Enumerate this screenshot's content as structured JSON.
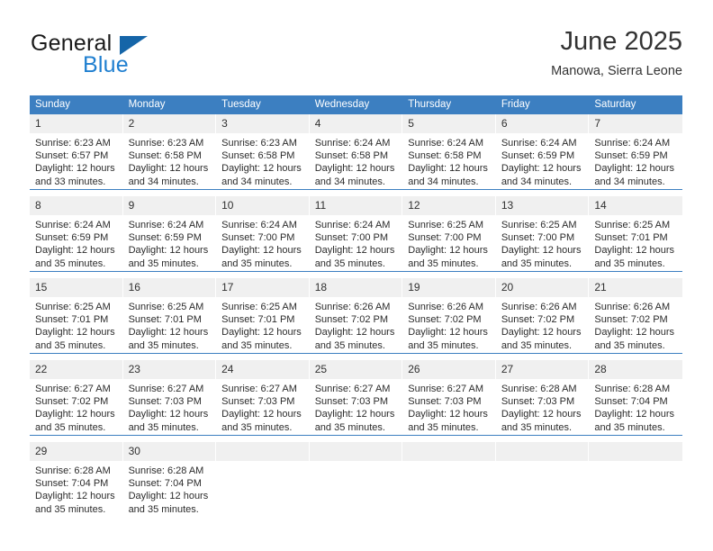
{
  "brand": {
    "name_part1": "General",
    "name_part2": "Blue",
    "triangle_icon": "brand-triangle-icon",
    "color_dark": "#1a1a1a",
    "color_blue": "#1f7fd0",
    "color_triangle": "#1565a8"
  },
  "header": {
    "title": "June 2025",
    "subtitle": "Manowa, Sierra Leone"
  },
  "theme": {
    "header_row_bg": "#3c7fc1",
    "header_row_text": "#ffffff",
    "daynum_bg": "#f0f0f0",
    "cell_bg": "#ffffff",
    "separator": "#3c7fc1"
  },
  "calendar": {
    "weekday_headers": [
      "Sunday",
      "Monday",
      "Tuesday",
      "Wednesday",
      "Thursday",
      "Friday",
      "Saturday"
    ],
    "weeks": [
      [
        {
          "day": "1",
          "sunrise": "Sunrise: 6:23 AM",
          "sunset": "Sunset: 6:57 PM",
          "daylight1": "Daylight: 12 hours",
          "daylight2": "and 33 minutes."
        },
        {
          "day": "2",
          "sunrise": "Sunrise: 6:23 AM",
          "sunset": "Sunset: 6:58 PM",
          "daylight1": "Daylight: 12 hours",
          "daylight2": "and 34 minutes."
        },
        {
          "day": "3",
          "sunrise": "Sunrise: 6:23 AM",
          "sunset": "Sunset: 6:58 PM",
          "daylight1": "Daylight: 12 hours",
          "daylight2": "and 34 minutes."
        },
        {
          "day": "4",
          "sunrise": "Sunrise: 6:24 AM",
          "sunset": "Sunset: 6:58 PM",
          "daylight1": "Daylight: 12 hours",
          "daylight2": "and 34 minutes."
        },
        {
          "day": "5",
          "sunrise": "Sunrise: 6:24 AM",
          "sunset": "Sunset: 6:58 PM",
          "daylight1": "Daylight: 12 hours",
          "daylight2": "and 34 minutes."
        },
        {
          "day": "6",
          "sunrise": "Sunrise: 6:24 AM",
          "sunset": "Sunset: 6:59 PM",
          "daylight1": "Daylight: 12 hours",
          "daylight2": "and 34 minutes."
        },
        {
          "day": "7",
          "sunrise": "Sunrise: 6:24 AM",
          "sunset": "Sunset: 6:59 PM",
          "daylight1": "Daylight: 12 hours",
          "daylight2": "and 34 minutes."
        }
      ],
      [
        {
          "day": "8",
          "sunrise": "Sunrise: 6:24 AM",
          "sunset": "Sunset: 6:59 PM",
          "daylight1": "Daylight: 12 hours",
          "daylight2": "and 35 minutes."
        },
        {
          "day": "9",
          "sunrise": "Sunrise: 6:24 AM",
          "sunset": "Sunset: 6:59 PM",
          "daylight1": "Daylight: 12 hours",
          "daylight2": "and 35 minutes."
        },
        {
          "day": "10",
          "sunrise": "Sunrise: 6:24 AM",
          "sunset": "Sunset: 7:00 PM",
          "daylight1": "Daylight: 12 hours",
          "daylight2": "and 35 minutes."
        },
        {
          "day": "11",
          "sunrise": "Sunrise: 6:24 AM",
          "sunset": "Sunset: 7:00 PM",
          "daylight1": "Daylight: 12 hours",
          "daylight2": "and 35 minutes."
        },
        {
          "day": "12",
          "sunrise": "Sunrise: 6:25 AM",
          "sunset": "Sunset: 7:00 PM",
          "daylight1": "Daylight: 12 hours",
          "daylight2": "and 35 minutes."
        },
        {
          "day": "13",
          "sunrise": "Sunrise: 6:25 AM",
          "sunset": "Sunset: 7:00 PM",
          "daylight1": "Daylight: 12 hours",
          "daylight2": "and 35 minutes."
        },
        {
          "day": "14",
          "sunrise": "Sunrise: 6:25 AM",
          "sunset": "Sunset: 7:01 PM",
          "daylight1": "Daylight: 12 hours",
          "daylight2": "and 35 minutes."
        }
      ],
      [
        {
          "day": "15",
          "sunrise": "Sunrise: 6:25 AM",
          "sunset": "Sunset: 7:01 PM",
          "daylight1": "Daylight: 12 hours",
          "daylight2": "and 35 minutes."
        },
        {
          "day": "16",
          "sunrise": "Sunrise: 6:25 AM",
          "sunset": "Sunset: 7:01 PM",
          "daylight1": "Daylight: 12 hours",
          "daylight2": "and 35 minutes."
        },
        {
          "day": "17",
          "sunrise": "Sunrise: 6:25 AM",
          "sunset": "Sunset: 7:01 PM",
          "daylight1": "Daylight: 12 hours",
          "daylight2": "and 35 minutes."
        },
        {
          "day": "18",
          "sunrise": "Sunrise: 6:26 AM",
          "sunset": "Sunset: 7:02 PM",
          "daylight1": "Daylight: 12 hours",
          "daylight2": "and 35 minutes."
        },
        {
          "day": "19",
          "sunrise": "Sunrise: 6:26 AM",
          "sunset": "Sunset: 7:02 PM",
          "daylight1": "Daylight: 12 hours",
          "daylight2": "and 35 minutes."
        },
        {
          "day": "20",
          "sunrise": "Sunrise: 6:26 AM",
          "sunset": "Sunset: 7:02 PM",
          "daylight1": "Daylight: 12 hours",
          "daylight2": "and 35 minutes."
        },
        {
          "day": "21",
          "sunrise": "Sunrise: 6:26 AM",
          "sunset": "Sunset: 7:02 PM",
          "daylight1": "Daylight: 12 hours",
          "daylight2": "and 35 minutes."
        }
      ],
      [
        {
          "day": "22",
          "sunrise": "Sunrise: 6:27 AM",
          "sunset": "Sunset: 7:02 PM",
          "daylight1": "Daylight: 12 hours",
          "daylight2": "and 35 minutes."
        },
        {
          "day": "23",
          "sunrise": "Sunrise: 6:27 AM",
          "sunset": "Sunset: 7:03 PM",
          "daylight1": "Daylight: 12 hours",
          "daylight2": "and 35 minutes."
        },
        {
          "day": "24",
          "sunrise": "Sunrise: 6:27 AM",
          "sunset": "Sunset: 7:03 PM",
          "daylight1": "Daylight: 12 hours",
          "daylight2": "and 35 minutes."
        },
        {
          "day": "25",
          "sunrise": "Sunrise: 6:27 AM",
          "sunset": "Sunset: 7:03 PM",
          "daylight1": "Daylight: 12 hours",
          "daylight2": "and 35 minutes."
        },
        {
          "day": "26",
          "sunrise": "Sunrise: 6:27 AM",
          "sunset": "Sunset: 7:03 PM",
          "daylight1": "Daylight: 12 hours",
          "daylight2": "and 35 minutes."
        },
        {
          "day": "27",
          "sunrise": "Sunrise: 6:28 AM",
          "sunset": "Sunset: 7:03 PM",
          "daylight1": "Daylight: 12 hours",
          "daylight2": "and 35 minutes."
        },
        {
          "day": "28",
          "sunrise": "Sunrise: 6:28 AM",
          "sunset": "Sunset: 7:04 PM",
          "daylight1": "Daylight: 12 hours",
          "daylight2": "and 35 minutes."
        }
      ],
      [
        {
          "day": "29",
          "sunrise": "Sunrise: 6:28 AM",
          "sunset": "Sunset: 7:04 PM",
          "daylight1": "Daylight: 12 hours",
          "daylight2": "and 35 minutes."
        },
        {
          "day": "30",
          "sunrise": "Sunrise: 6:28 AM",
          "sunset": "Sunset: 7:04 PM",
          "daylight1": "Daylight: 12 hours",
          "daylight2": "and 35 minutes."
        },
        {
          "day": "",
          "sunrise": "",
          "sunset": "",
          "daylight1": "",
          "daylight2": ""
        },
        {
          "day": "",
          "sunrise": "",
          "sunset": "",
          "daylight1": "",
          "daylight2": ""
        },
        {
          "day": "",
          "sunrise": "",
          "sunset": "",
          "daylight1": "",
          "daylight2": ""
        },
        {
          "day": "",
          "sunrise": "",
          "sunset": "",
          "daylight1": "",
          "daylight2": ""
        },
        {
          "day": "",
          "sunrise": "",
          "sunset": "",
          "daylight1": "",
          "daylight2": ""
        }
      ]
    ]
  }
}
